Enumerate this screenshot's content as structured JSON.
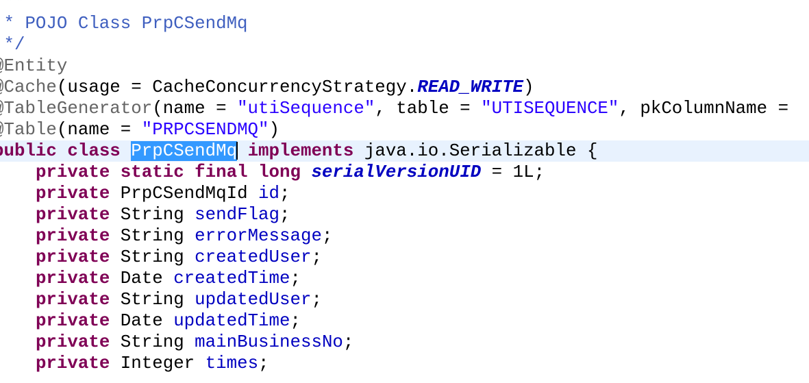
{
  "editor": {
    "lines": [
      [
        {
          "t": "/**",
          "c": "comment"
        }
      ],
      [
        {
          "t": " * POJO Class PrpCSendMq",
          "c": "comment"
        }
      ],
      [
        {
          "t": " */",
          "c": "comment"
        }
      ],
      [
        {
          "t": "@Entity",
          "c": "anno"
        }
      ],
      [
        {
          "t": "@Cache",
          "c": "anno"
        },
        {
          "t": "(usage = CacheConcurrencyStrategy."
        },
        {
          "t": "READ_WRITE",
          "c": "static-field"
        },
        {
          "t": ")"
        }
      ],
      [
        {
          "t": "@TableGenerator",
          "c": "anno"
        },
        {
          "t": "(name = "
        },
        {
          "t": "\"utiSequence\"",
          "c": "str"
        },
        {
          "t": ", table = "
        },
        {
          "t": "\"UTISEQUENCE\"",
          "c": "str"
        },
        {
          "t": ", pkColumnName = "
        }
      ],
      [
        {
          "t": "@Table",
          "c": "anno"
        },
        {
          "t": "(name = "
        },
        {
          "t": "\"PRPCSENDMQ\"",
          "c": "str"
        },
        {
          "t": ")"
        }
      ],
      [
        {
          "t": "public",
          "c": "kw"
        },
        {
          "t": " "
        },
        {
          "t": "class",
          "c": "kw"
        },
        {
          "t": " "
        },
        {
          "t": "PrpCSendMq",
          "c": "sel"
        },
        {
          "t": "",
          "caret": true
        },
        {
          "t": " "
        },
        {
          "t": "implements",
          "c": "kw"
        },
        {
          "t": " java.io.Serializable {"
        }
      ],
      [
        {
          "t": "    "
        },
        {
          "t": "private",
          "c": "kw"
        },
        {
          "t": " "
        },
        {
          "t": "static",
          "c": "kw"
        },
        {
          "t": " "
        },
        {
          "t": "final",
          "c": "kw"
        },
        {
          "t": " "
        },
        {
          "t": "long",
          "c": "kw"
        },
        {
          "t": " "
        },
        {
          "t": "serialVersionUID",
          "c": "static-field"
        },
        {
          "t": " = 1L;"
        }
      ],
      [
        {
          "t": "    "
        },
        {
          "t": "private",
          "c": "kw"
        },
        {
          "t": " PrpCSendMqId "
        },
        {
          "t": "id",
          "c": "field"
        },
        {
          "t": ";"
        }
      ],
      [
        {
          "t": "    "
        },
        {
          "t": "private",
          "c": "kw"
        },
        {
          "t": " String "
        },
        {
          "t": "sendFlag",
          "c": "field"
        },
        {
          "t": ";"
        }
      ],
      [
        {
          "t": "    "
        },
        {
          "t": "private",
          "c": "kw"
        },
        {
          "t": " String "
        },
        {
          "t": "errorMessage",
          "c": "field"
        },
        {
          "t": ";"
        }
      ],
      [
        {
          "t": "    "
        },
        {
          "t": "private",
          "c": "kw"
        },
        {
          "t": " String "
        },
        {
          "t": "createdUser",
          "c": "field"
        },
        {
          "t": ";"
        }
      ],
      [
        {
          "t": "    "
        },
        {
          "t": "private",
          "c": "kw"
        },
        {
          "t": " Date "
        },
        {
          "t": "createdTime",
          "c": "field"
        },
        {
          "t": ";"
        }
      ],
      [
        {
          "t": "    "
        },
        {
          "t": "private",
          "c": "kw"
        },
        {
          "t": " String "
        },
        {
          "t": "updatedUser",
          "c": "field"
        },
        {
          "t": ";"
        }
      ],
      [
        {
          "t": "    "
        },
        {
          "t": "private",
          "c": "kw"
        },
        {
          "t": " Date "
        },
        {
          "t": "updatedTime",
          "c": "field"
        },
        {
          "t": ";"
        }
      ],
      [
        {
          "t": "    "
        },
        {
          "t": "private",
          "c": "kw"
        },
        {
          "t": " String "
        },
        {
          "t": "mainBusinessNo",
          "c": "field"
        },
        {
          "t": ";"
        }
      ],
      [
        {
          "t": "    "
        },
        {
          "t": "private",
          "c": "kw"
        },
        {
          "t": " Integer "
        },
        {
          "t": "times",
          "c": "field"
        },
        {
          "t": ";"
        }
      ]
    ],
    "current_line": 7,
    "colors": {
      "comment": "#3f5fbf",
      "annotation": "#646464",
      "keyword": "#7f0055",
      "string": "#2a00ff",
      "field": "#0000c0",
      "selection": "#3399ff",
      "current_line": "#e8f2fe"
    }
  }
}
